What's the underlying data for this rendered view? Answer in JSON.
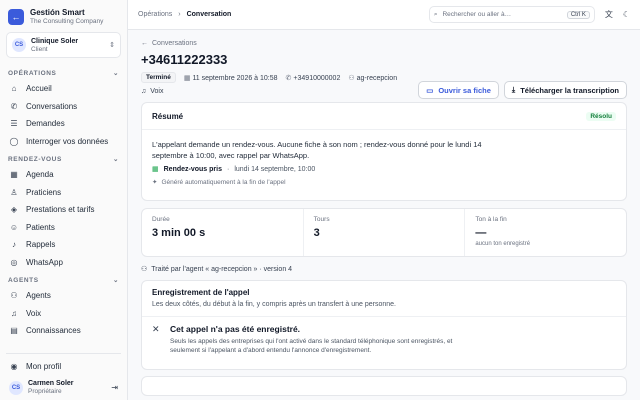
{
  "brand": {
    "title": "Gestión Smart",
    "subtitle": "The Consulting Company",
    "logo_glyph": "←"
  },
  "org": {
    "initials": "CS",
    "name": "Clinique Soler",
    "role": "Client"
  },
  "sidebar": {
    "sections": [
      {
        "title": "OPÉRATIONS",
        "items": [
          {
            "label": "Accueil",
            "icon": "home-icon"
          },
          {
            "label": "Conversations",
            "icon": "phone-icon"
          },
          {
            "label": "Demandes",
            "icon": "list-icon"
          },
          {
            "label": "Interroger vos données",
            "icon": "chat-icon"
          }
        ]
      },
      {
        "title": "RENDEZ-VOUS",
        "items": [
          {
            "label": "Agenda",
            "icon": "calendar-icon"
          },
          {
            "label": "Praticiens",
            "icon": "users-icon"
          },
          {
            "label": "Prestations et tarifs",
            "icon": "tag-icon"
          },
          {
            "label": "Patients",
            "icon": "user-icon"
          },
          {
            "label": "Rappels",
            "icon": "bell-icon"
          },
          {
            "label": "WhatsApp",
            "icon": "whatsapp-icon"
          }
        ]
      },
      {
        "title": "AGENTS",
        "items": [
          {
            "label": "Agents",
            "icon": "bot-icon"
          },
          {
            "label": "Voix",
            "icon": "audio-icon"
          },
          {
            "label": "Connaissances",
            "icon": "book-icon"
          }
        ]
      }
    ],
    "profile_label": "Mon profil",
    "user": {
      "initials": "CS",
      "name": "Carmen Soler",
      "role": "Propriétaire"
    }
  },
  "topbar": {
    "breadcrumb": [
      "Opérations",
      "Conversation"
    ],
    "search_placeholder": "Rechercher ou aller à…",
    "shortcut": "Ctrl K"
  },
  "conversation": {
    "back_label": "Conversations",
    "title": "+34611222333",
    "status": "Terminé",
    "datetime": "11 septembre 2026 à 10:58",
    "phone": "+34910000002",
    "agent": "ag-recepcion",
    "channel": "Voix",
    "open_sheet_label": "Ouvrir sa fiche",
    "download_label": "Télécharger la transcription"
  },
  "summary": {
    "title": "Résumé",
    "badge": "Résolu",
    "text": "L'appelant demande un rendez-vous. Aucune fiche à son nom ; rendez-vous donné pour le lundi 14 septembre à 10:00, avec rappel par WhatsApp.",
    "outcome_label": "Rendez-vous pris",
    "outcome_value": "lundi 14 septembre, 10:00",
    "generated_note": "Généré automatiquement à la fin de l'appel"
  },
  "stats": [
    {
      "label": "Durée",
      "value": "3 min 00 s",
      "sub": ""
    },
    {
      "label": "Tours",
      "value": "3",
      "sub": ""
    },
    {
      "label": "Ton à la fin",
      "value": "—",
      "sub": "aucun ton enregistré"
    }
  ],
  "agent_line": "Traité par l'agent « ag-recepcion » · version 4",
  "recording": {
    "title": "Enregistrement de l'appel",
    "subtitle": "Les deux côtés, du début à la fin, y compris après un transfert à une personne.",
    "notice_title": "Cet appel n'a pas été enregistré.",
    "notice_body": "Seuls les appels des entreprises qui l'ont activé dans le standard téléphonique sont enregistrés, et seulement si l'appelant a d'abord entendu l'annonce d'enregistrement."
  },
  "colors": {
    "accent": "#3b5bdb",
    "success": "#15803d",
    "background": "#f8f9fb"
  }
}
